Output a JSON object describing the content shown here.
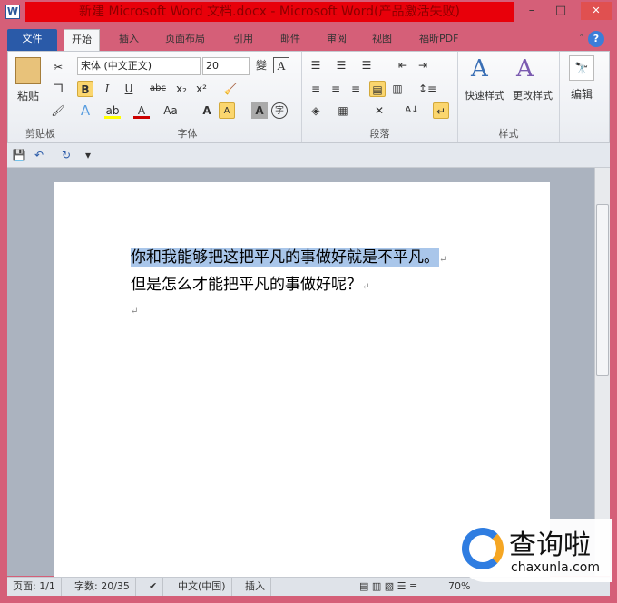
{
  "window": {
    "title": "新建 Microsoft Word 文档.docx - Microsoft Word(产品激活失败)",
    "app_icon": "W",
    "minimize": "–",
    "maximize": "□",
    "close": "✕"
  },
  "tabs": [
    "文件",
    "开始",
    "插入",
    "页面布局",
    "引用",
    "邮件",
    "审阅",
    "视图",
    "福昕PDF"
  ],
  "ribbon": {
    "clipboard": {
      "label": "剪贴板",
      "paste": "粘贴"
    },
    "font": {
      "label": "字体",
      "font_name": "宋体 (中文正文)",
      "font_size": "20",
      "bold": "B",
      "italic": "I",
      "underline": "U",
      "strike": "abc",
      "sub": "x₂",
      "sup": "x²",
      "grow": "A",
      "shrink": "A",
      "aa": "Aa",
      "font_color": "A",
      "wen": "變",
      "a_box": "A",
      "zi": "字"
    },
    "paragraph": {
      "label": "段落"
    },
    "styles": {
      "label": "样式",
      "quick": "快速样式",
      "change": "更改样式"
    },
    "editing": {
      "label": "编辑"
    }
  },
  "document": {
    "lines": [
      "你和我能够把这把平凡的事做好就是不平凡。",
      "但是怎么才能把平凡的事做好呢？"
    ],
    "para_mark": "↵"
  },
  "status": {
    "page": "页面: 1/1",
    "words": "字数: 20/35",
    "language": "中文(中国)",
    "mode": "插入",
    "zoom": "70%"
  },
  "watermark": {
    "text": "查询啦",
    "url": "chaxunla.com"
  },
  "colors": {
    "border": "#d55f78",
    "title_highlight": "#e8000a",
    "file_tab": "#2a5aa8",
    "selection": "#a9c6ea"
  }
}
